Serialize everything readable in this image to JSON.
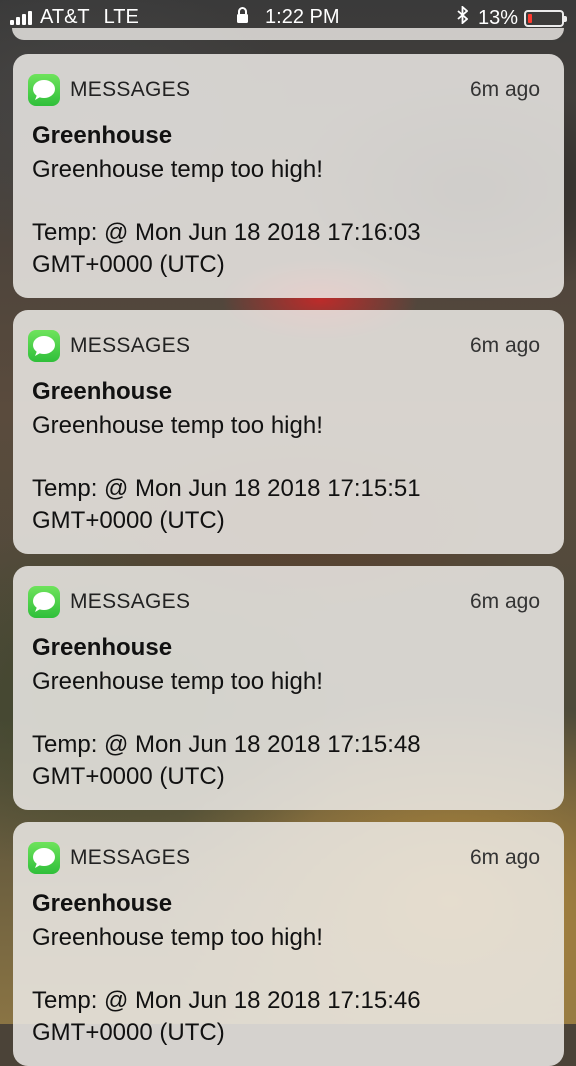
{
  "status_bar": {
    "carrier": "AT&T",
    "network": "LTE",
    "time": "1:22 PM",
    "battery": "13%",
    "battery_level": 0.13,
    "battery_color": "#ff3b30"
  },
  "notifications": [
    {
      "app": "MESSAGES",
      "time": "6m ago",
      "title": "Greenhouse",
      "line1": "Greenhouse temp too high!",
      "line2": "Temp:  @ Mon Jun 18 2018 17:16:03",
      "line3": "GMT+0000 (UTC)"
    },
    {
      "app": "MESSAGES",
      "time": "6m ago",
      "title": "Greenhouse",
      "line1": "Greenhouse temp too high!",
      "line2": "Temp:  @ Mon Jun 18 2018 17:15:51",
      "line3": "GMT+0000 (UTC)"
    },
    {
      "app": "MESSAGES",
      "time": "6m ago",
      "title": "Greenhouse",
      "line1": "Greenhouse temp too high!",
      "line2": "Temp:  @ Mon Jun 18 2018 17:15:48",
      "line3": "GMT+0000 (UTC)"
    },
    {
      "app": "MESSAGES",
      "time": "6m ago",
      "title": "Greenhouse",
      "line1": "Greenhouse temp too high!",
      "line2": "Temp:  @ Mon Jun 18 2018 17:15:46",
      "line3": "GMT+0000 (UTC)"
    }
  ],
  "colors": {
    "messages_icon": "#34c759"
  }
}
